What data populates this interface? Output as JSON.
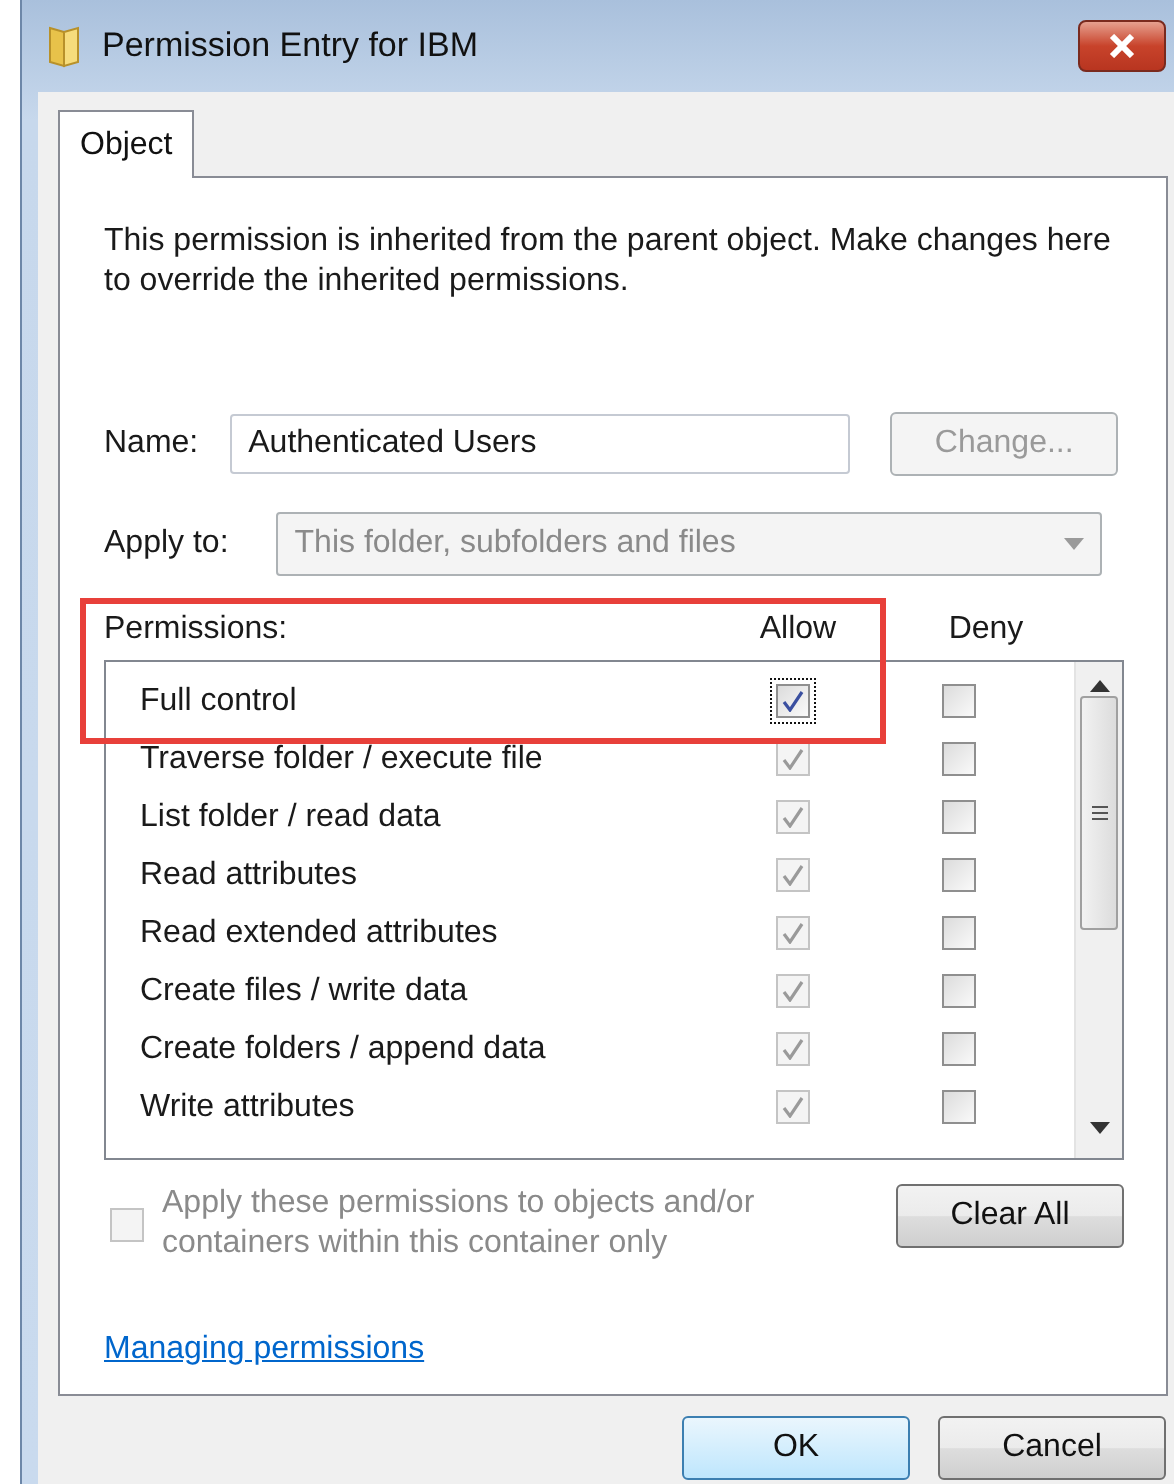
{
  "window": {
    "title": "Permission Entry for IBM"
  },
  "tabs": [
    {
      "label": "Object",
      "selected": true
    }
  ],
  "notice": "This permission is inherited from the parent object. Make changes here to override the inherited permissions.",
  "name": {
    "label": "Name:",
    "value": "Authenticated Users",
    "button": {
      "label": "Change...",
      "disabled": true
    }
  },
  "apply_to": {
    "label": "Apply to:",
    "value": "This folder, subfolders and files",
    "disabled": true
  },
  "permissions": {
    "label": "Permissions:",
    "columns": [
      "Allow",
      "Deny"
    ],
    "rows": [
      {
        "name": "Full control",
        "allow": true,
        "allow_disabled": false,
        "deny": false,
        "deny_disabled": false,
        "focused": true
      },
      {
        "name": "Traverse folder / execute file",
        "allow": true,
        "allow_disabled": true,
        "deny": false,
        "deny_disabled": false,
        "focused": false
      },
      {
        "name": "List folder / read data",
        "allow": true,
        "allow_disabled": true,
        "deny": false,
        "deny_disabled": false,
        "focused": false
      },
      {
        "name": "Read attributes",
        "allow": true,
        "allow_disabled": true,
        "deny": false,
        "deny_disabled": false,
        "focused": false
      },
      {
        "name": "Read extended attributes",
        "allow": true,
        "allow_disabled": true,
        "deny": false,
        "deny_disabled": false,
        "focused": false
      },
      {
        "name": "Create files / write data",
        "allow": true,
        "allow_disabled": true,
        "deny": false,
        "deny_disabled": false,
        "focused": false
      },
      {
        "name": "Create folders / append data",
        "allow": true,
        "allow_disabled": true,
        "deny": false,
        "deny_disabled": false,
        "focused": false
      },
      {
        "name": "Write attributes",
        "allow": true,
        "allow_disabled": true,
        "deny": false,
        "deny_disabled": false,
        "focused": false
      }
    ]
  },
  "inherit_option": {
    "label": "Apply these permissions to objects and/or containers within this container only",
    "checked": false,
    "disabled": true
  },
  "clear_button": {
    "label": "Clear All"
  },
  "link": "Managing permissions",
  "buttons": [
    {
      "label": "OK",
      "default": true
    },
    {
      "label": "Cancel",
      "default": false
    }
  ]
}
